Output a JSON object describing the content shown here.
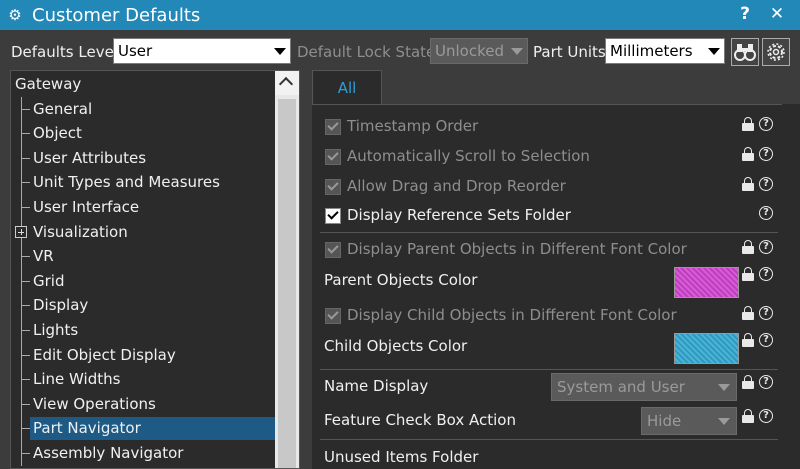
{
  "window": {
    "title": "Customer Defaults",
    "help_button": "?",
    "close_button": "✕"
  },
  "toolbar": {
    "defaults_level_label": "Defaults Level",
    "defaults_level_value": "User",
    "default_lock_state_label": "Default Lock State",
    "default_lock_state_value": "Unlocked",
    "part_units_label": "Part Units",
    "part_units_value": "Millimeters",
    "find_button": "binoculars-icon",
    "settings_button": "gear-icon"
  },
  "tree": {
    "root": "Gateway",
    "items": [
      {
        "label": "General",
        "expandable": false,
        "selected": false
      },
      {
        "label": "Object",
        "expandable": false,
        "selected": false
      },
      {
        "label": "User Attributes",
        "expandable": false,
        "selected": false
      },
      {
        "label": "Unit Types and Measures",
        "expandable": false,
        "selected": false
      },
      {
        "label": "User Interface",
        "expandable": false,
        "selected": false
      },
      {
        "label": "Visualization",
        "expandable": true,
        "selected": false
      },
      {
        "label": "VR",
        "expandable": false,
        "selected": false
      },
      {
        "label": "Grid",
        "expandable": false,
        "selected": false
      },
      {
        "label": "Display",
        "expandable": false,
        "selected": false
      },
      {
        "label": "Lights",
        "expandable": false,
        "selected": false
      },
      {
        "label": "Edit Object Display",
        "expandable": false,
        "selected": false
      },
      {
        "label": "Line Widths",
        "expandable": false,
        "selected": false
      },
      {
        "label": "View Operations",
        "expandable": false,
        "selected": false
      },
      {
        "label": "Part Navigator",
        "expandable": false,
        "selected": true
      },
      {
        "label": "Assembly Navigator",
        "expandable": false,
        "selected": false
      }
    ]
  },
  "tabs": [
    "All"
  ],
  "settings": {
    "timestamp_order": {
      "label": "Timestamp Order",
      "checked": true,
      "enabled": false
    },
    "auto_scroll": {
      "label": "Automatically Scroll to Selection",
      "checked": true,
      "enabled": false
    },
    "drag_drop": {
      "label": "Allow Drag and Drop Reorder",
      "checked": true,
      "enabled": false
    },
    "ref_sets_folder": {
      "label": "Display Reference Sets Folder",
      "checked": true,
      "enabled": true
    },
    "parent_font_color": {
      "label": "Display Parent Objects in Different Font Color",
      "checked": true,
      "enabled": false
    },
    "parent_color_label": "Parent Objects Color",
    "parent_color": "#c23bc2",
    "child_font_color": {
      "label": "Display Child Objects in Different Font Color",
      "checked": true,
      "enabled": false
    },
    "child_color_label": "Child Objects Color",
    "child_color": "#2f99bf",
    "name_display_label": "Name Display",
    "name_display_value": "System and User",
    "feature_check_label": "Feature Check Box Action",
    "feature_check_value": "Hide",
    "unused_items_label": "Unused Items Folder"
  },
  "colors": {
    "title_bar": "#2288b8",
    "selection": "#1d5a86",
    "tab_text": "#2c9fd9"
  }
}
